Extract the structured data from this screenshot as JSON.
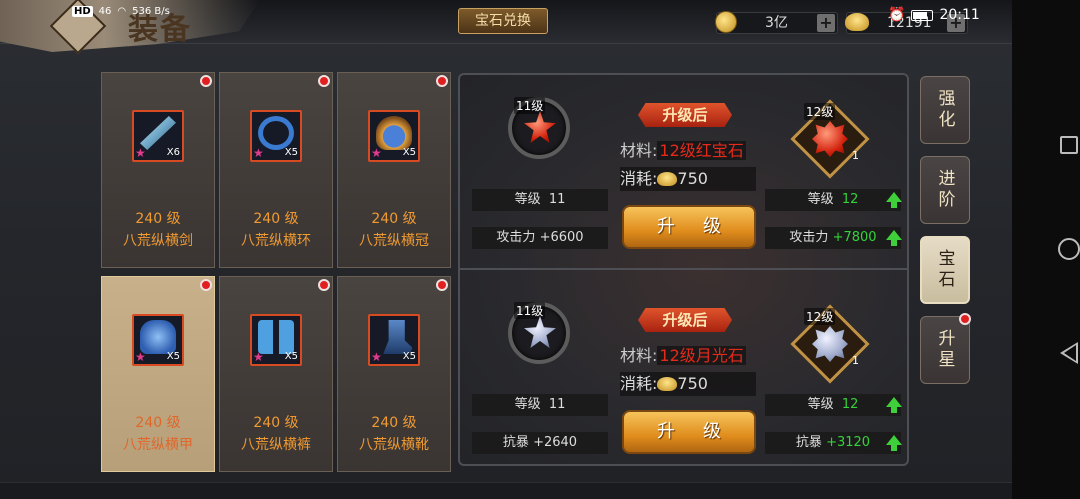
{
  "status_bar": {
    "left_badge": "HD",
    "network": "46",
    "speed": "536 B/s",
    "time": "20:11"
  },
  "header": {
    "title": "装备",
    "exchange_label": "宝石兑换",
    "silver_amount": "3亿",
    "gold_amount": "12191"
  },
  "items": [
    {
      "level": "240 级",
      "name": "八荒纵横剑",
      "qty": "X6",
      "art_color": "#6fa8c8"
    },
    {
      "level": "240 级",
      "name": "八荒纵横环",
      "qty": "X5",
      "art_color": "#3a7ad0"
    },
    {
      "level": "240 级",
      "name": "八荒纵横冠",
      "qty": "X5",
      "art_color": "#e0a040"
    },
    {
      "level": "240 级",
      "name": "八荒纵横甲",
      "qty": "X5",
      "art_color": "#4a80d8"
    },
    {
      "level": "240 级",
      "name": "八荒纵横裤",
      "qty": "X5",
      "art_color": "#4fa0e0"
    },
    {
      "level": "240 级",
      "name": "八荒纵横靴",
      "qty": "X5",
      "art_color": "#5a88c8"
    }
  ],
  "gems": [
    {
      "from_level": "11级",
      "to_level": "12级",
      "to_count": "1",
      "banner": "升级后",
      "material_label": "材料:",
      "material_name": "12级红宝石",
      "cost_label": "消耗:",
      "cost_value": "750",
      "cur_level_label": "等级",
      "cur_level": "11",
      "next_level_label": "等级",
      "next_level": "12",
      "cur_stat_label": "攻击力",
      "cur_stat": "+6600",
      "next_stat_label": "攻击力",
      "next_stat": "+7800",
      "button": "升级",
      "color": "#e8381f"
    },
    {
      "from_level": "11级",
      "to_level": "12级",
      "to_count": "1",
      "banner": "升级后",
      "material_label": "材料:",
      "material_name": "12级月光石",
      "cost_label": "消耗:",
      "cost_value": "750",
      "cur_level_label": "等级",
      "cur_level": "11",
      "next_level_label": "等级",
      "next_level": "12",
      "cur_stat_label": "抗暴",
      "cur_stat": "+2640",
      "next_stat_label": "抗暴",
      "next_stat": "+3120",
      "button": "升级",
      "color": "#9aa6c8"
    }
  ],
  "tabs": [
    {
      "label": "强化"
    },
    {
      "label": "进阶"
    },
    {
      "label": "宝石"
    },
    {
      "label": "升星"
    }
  ]
}
